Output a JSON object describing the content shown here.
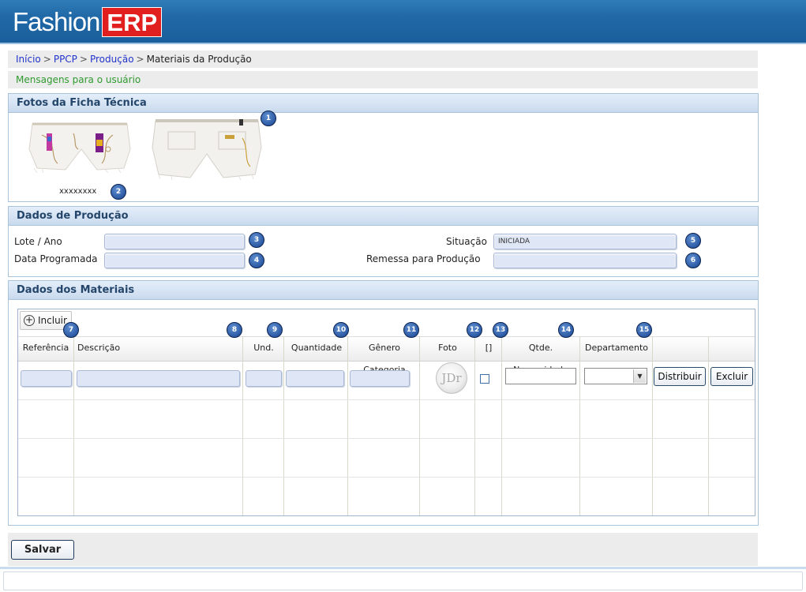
{
  "app": {
    "logo_text": "Fashion",
    "logo_badge": "ERP"
  },
  "breadcrumb": {
    "items": [
      "Início",
      "PPCP",
      "Produção"
    ],
    "current": "Materiais da Produção",
    "separator": ">"
  },
  "messages": {
    "text": "Mensagens para o usuário"
  },
  "fotos": {
    "title": "Fotos da Ficha Técnica",
    "caption": "xxxxxxxx",
    "badges": [
      "1",
      "2"
    ]
  },
  "producao": {
    "title": "Dados de Produção",
    "lote_label": "Lote / Ano",
    "data_label": "Data Programada",
    "situacao_label": "Situação",
    "situacao_value": "INICIADA",
    "remessa_label": "Remessa para Produção",
    "badges": [
      "3",
      "4",
      "5",
      "6"
    ]
  },
  "materiais": {
    "title": "Dados dos Materiais",
    "incluir_label": "Incluir",
    "columns": [
      "Referência",
      "Descrição",
      "Und.",
      "Quantidade",
      "Gênero Categoria",
      "Foto",
      "[]",
      "Qtde. Necessidade",
      "Departamento"
    ],
    "badges": [
      "7",
      "8",
      "9",
      "10",
      "11",
      "12",
      "13",
      "14",
      "15"
    ],
    "photo_placeholder": "JDr",
    "distribuir_label": "Distribuir",
    "excluir_label": "Excluir"
  },
  "footer": {
    "salvar_label": "Salvar"
  }
}
